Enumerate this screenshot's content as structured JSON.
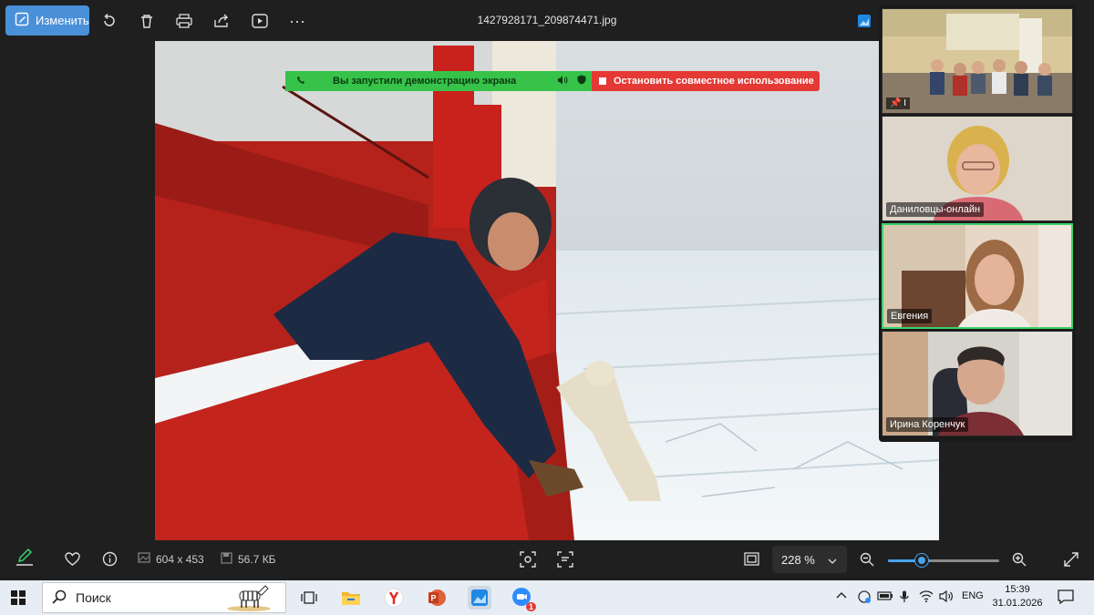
{
  "toolbar": {
    "edit_label": "Изменить",
    "filename": "1427928171_209874471.jpg",
    "icons": [
      "edit-icon",
      "rotate-icon",
      "delete-icon",
      "print-icon",
      "share-icon",
      "slideshow-icon",
      "more-icon",
      "photos-app-icon"
    ]
  },
  "share_banner": {
    "message": "Вы запустили демонстрацию экрана",
    "stop_label": "Остановить совместное использование",
    "left_color": "#37c24a",
    "right_color": "#e53935"
  },
  "participants": [
    {
      "name": "",
      "pin_label": "I"
    },
    {
      "name": "Даниловцы-онлайн"
    },
    {
      "name": "Евгения",
      "active": true
    },
    {
      "name": "Ирина Коренчук"
    }
  ],
  "status": {
    "dimensions": "604 x 453",
    "filesize": "56.7 КБ",
    "zoom_value": "228 %",
    "zoom_fraction": 0.3
  },
  "taskbar": {
    "search_placeholder": "Поиск",
    "language": "ENG",
    "time": "15:39",
    "date": "31.01.2026",
    "zoom_badge": "1"
  },
  "colors": {
    "accent": "#4a90d9",
    "active_border": "#3ad26a"
  }
}
